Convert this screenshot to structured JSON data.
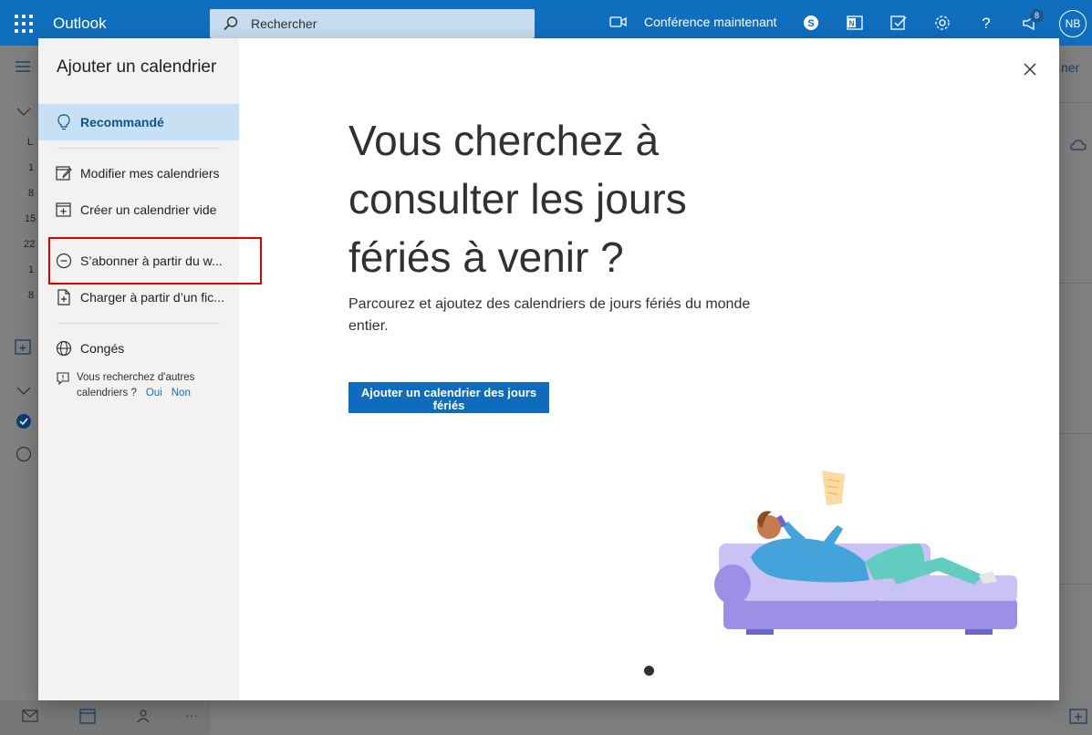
{
  "topbar": {
    "app_name": "Outlook",
    "search_placeholder": "Rechercher",
    "meet_now_label": "Conférence maintenant",
    "notification_count": "8",
    "avatar_initials": "NB"
  },
  "background": {
    "left_rail_numbers": [
      "L",
      "1",
      "8",
      "15",
      "22",
      "1",
      "8"
    ],
    "right_peek_text": "ner"
  },
  "dialog": {
    "title": "Ajouter un calendrier",
    "sidebar_items": [
      {
        "label": "Recommandé",
        "icon": "lightbulb-icon",
        "active": true
      },
      {
        "label": "Modifier mes calendriers",
        "icon": "edit-calendar-icon",
        "active": false
      },
      {
        "label": "Créer un calendrier vide",
        "icon": "calendar-add-icon",
        "active": false
      },
      {
        "label": "S’abonner à partir du w...",
        "icon": "link-icon",
        "active": false
      },
      {
        "label": "Charger à partir d’un fic...",
        "icon": "file-upload-icon",
        "active": false
      },
      {
        "label": "Congés",
        "icon": "globe-icon",
        "active": false
      }
    ],
    "feedback": {
      "question": "Vous recherchez d'autres calendriers ?",
      "yes": "Oui",
      "no": "Non"
    },
    "headline": "Vous cherchez à consulter les jours fériés à venir ?",
    "subtext": "Parcourez et ajoutez des calendriers de jours fériés du monde entier.",
    "cta_label": "Ajouter un calendrier des jours fériés",
    "pagination": {
      "current": 1,
      "total": 1
    }
  },
  "colors": {
    "brand": "#106ebe",
    "active_item_bg": "#c7e0f4",
    "highlight_border": "#e00000"
  }
}
